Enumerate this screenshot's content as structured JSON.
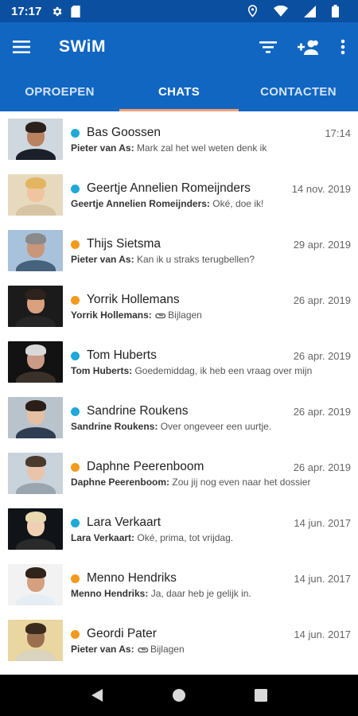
{
  "status_bar": {
    "time": "17:17",
    "icons": [
      "gear-icon",
      "sim-card-icon",
      "location-icon",
      "wifi-icon",
      "signal-icon",
      "battery-icon"
    ]
  },
  "app_bar": {
    "title": "SWiM",
    "icons": [
      "menu-icon",
      "filter-icon",
      "add-group-icon",
      "more-vert-icon"
    ]
  },
  "tabs": [
    {
      "label": "OPROEPEN"
    },
    {
      "label": "CHATS"
    },
    {
      "label": "CONTACTEN"
    }
  ],
  "active_tab": "CHATS",
  "colors": {
    "primary": "#1166c2",
    "status_bar": "#0b4fa0",
    "tab_indicator": "#f0a073",
    "online": "#1fa8d8",
    "away": "#f39a1e"
  },
  "chats": [
    {
      "name": "Bas Goossen",
      "time": "17:14",
      "status": "online",
      "sender": "Pieter van As:",
      "message": "Mark zal het wel weten denk ik",
      "attachment": false
    },
    {
      "name": "Geertje Annelien Romeijnders",
      "time": "14 nov. 2019",
      "status": "online",
      "sender": "Geertje Annelien Romeijnders:",
      "message": "Oké, doe ik!",
      "attachment": false
    },
    {
      "name": "Thijs Sietsma",
      "time": "29 apr. 2019",
      "status": "away",
      "sender": "Pieter van As:",
      "message": "Kan ik u straks terugbellen?",
      "attachment": false
    },
    {
      "name": "Yorrik Hollemans",
      "time": "26 apr. 2019",
      "status": "away",
      "sender": "Yorrik Hollemans:",
      "message": "Bijlagen",
      "attachment": true
    },
    {
      "name": "Tom Huberts",
      "time": "26 apr. 2019",
      "status": "online",
      "sender": "Tom Huberts:",
      "message": "Goedemiddag, ik heb een vraag over mijn",
      "attachment": false
    },
    {
      "name": "Sandrine Roukens",
      "time": "26 apr. 2019",
      "status": "online",
      "sender": "Sandrine Roukens:",
      "message": "Over ongeveer een uurtje.",
      "attachment": false
    },
    {
      "name": "Daphne Peerenboom",
      "time": "26 apr. 2019",
      "status": "away",
      "sender": "Daphne Peerenboom:",
      "message": "Zou jij nog even naar het dossier",
      "attachment": false
    },
    {
      "name": "Lara Verkaart",
      "time": "14 jun. 2017",
      "status": "online",
      "sender": "Lara Verkaart:",
      "message": "Oké, prima, tot vrijdag.",
      "attachment": false
    },
    {
      "name": "Menno Hendriks",
      "time": "14 jun. 2017",
      "status": "away",
      "sender": "Menno Hendriks:",
      "message": "Ja, daar heb je gelijk in.",
      "attachment": false
    },
    {
      "name": "Geordi Pater",
      "time": "14 jun. 2017",
      "status": "away",
      "sender": "Pieter van As:",
      "message": "Bijlagen",
      "attachment": true
    }
  ],
  "nav_bar": {
    "icons": [
      "back-icon",
      "home-icon",
      "recents-icon"
    ]
  }
}
